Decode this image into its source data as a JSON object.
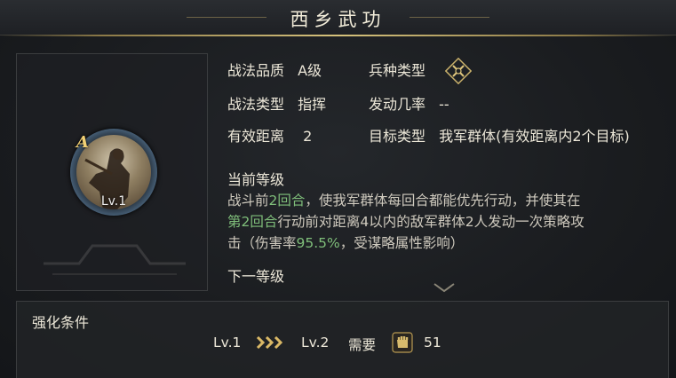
{
  "window": {
    "title": "西乡武功"
  },
  "skill": {
    "grade_badge": "A",
    "level_badge": "Lv.1",
    "attributes": {
      "quality_label": "战法品质",
      "quality_value": "A级",
      "troop_label": "兵种类型",
      "troop_icon": "crossed-weapons-icon",
      "type_label": "战法类型",
      "type_value": "指挥",
      "rate_label": "发动几率",
      "rate_value": "--",
      "distance_label": "有效距离",
      "distance_value": "2",
      "target_label": "目标类型",
      "target_value": "我军群体(有效距离内2个目标)"
    }
  },
  "description": {
    "current_heading": "当前等级",
    "line1_a": "战斗前",
    "line1_hl": "2回合",
    "line1_b": "，使我军群体每回合都能优先行动，并使其在",
    "line2_hl": "第2回合",
    "line2_b": "行动前对距离4以内的敌军群体2人发动一次策略攻",
    "line3_a": "击（伤害率",
    "line3_hl": "95.5%",
    "line3_b": "，受谋略属性影响）",
    "next_heading": "下一等级",
    "highlight_color": "#7fbe7a"
  },
  "enhance": {
    "title": "强化条件",
    "from_level": "Lv.1",
    "to_level": "Lv.2",
    "need_label": "需要",
    "cost_icon": "fist-icon",
    "cost_value": "51"
  },
  "colors": {
    "gold": "#d6c27c",
    "text": "#ece7d8"
  }
}
